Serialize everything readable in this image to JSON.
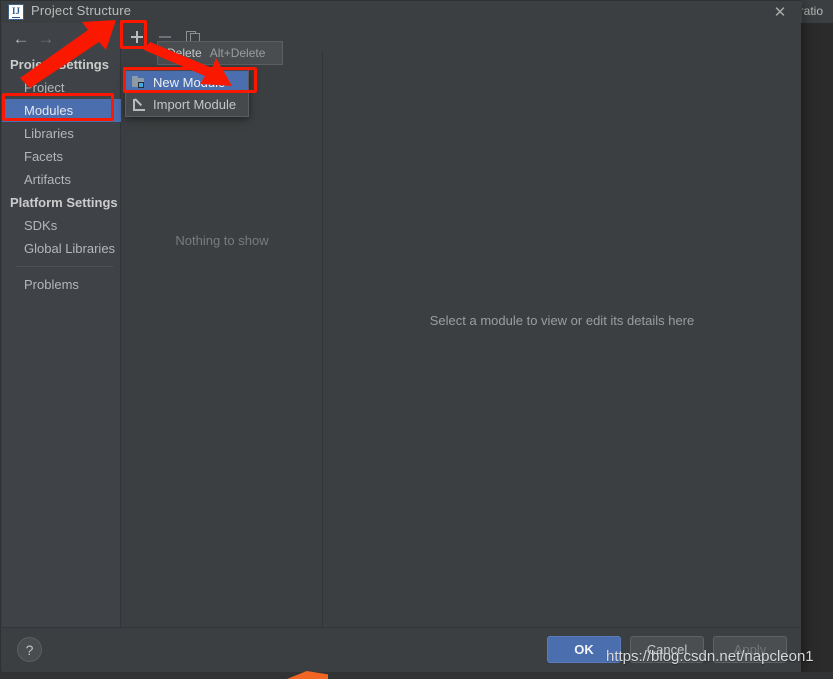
{
  "window": {
    "title": "Project Structure",
    "app_icon": "IJ",
    "close_label": "✕"
  },
  "background": {
    "toolbar_partial_text": "uratio"
  },
  "navigation": {
    "back_icon": "←",
    "forward_icon": "→"
  },
  "sidebar": {
    "groups": [
      {
        "label": "Project Settings",
        "items": [
          {
            "label": "Project",
            "selected": false
          },
          {
            "label": "Modules",
            "selected": true
          },
          {
            "label": "Libraries",
            "selected": false
          },
          {
            "label": "Facets",
            "selected": false
          },
          {
            "label": "Artifacts",
            "selected": false
          }
        ]
      },
      {
        "label": "Platform Settings",
        "items": [
          {
            "label": "SDKs",
            "selected": false
          },
          {
            "label": "Global Libraries",
            "selected": false
          }
        ]
      }
    ],
    "problems": {
      "label": "Problems",
      "selected": false
    }
  },
  "module_toolbar": {
    "add_icon": "plus-icon",
    "remove_icon": "minus-icon",
    "copy_icon": "copy-icon"
  },
  "module_list": {
    "empty_text": "Nothing to show"
  },
  "detail_pane": {
    "hint": "Select a module to view or edit its details here"
  },
  "tooltip": {
    "label": "Delete",
    "shortcut": "Alt+Delete"
  },
  "popup_menu": {
    "items": [
      {
        "label": "New Module",
        "icon": "new-module-icon",
        "active": true
      },
      {
        "label": "Import Module",
        "icon": "import-module-icon",
        "active": false
      }
    ]
  },
  "footer": {
    "help_label": "?",
    "ok_label": "OK",
    "cancel_label": "Cancel",
    "apply_label": "Apply"
  },
  "watermark": {
    "text": "https://blog.csdn.net/napcleon1"
  },
  "colors": {
    "dialog_bg": "#3c3f41",
    "sidebar_bg": "#3f4246",
    "selection_blue": "#4b6eaf",
    "annotation_red": "#fa1800",
    "orange_accent": "#f26522",
    "text_primary": "#b4b7ba"
  }
}
